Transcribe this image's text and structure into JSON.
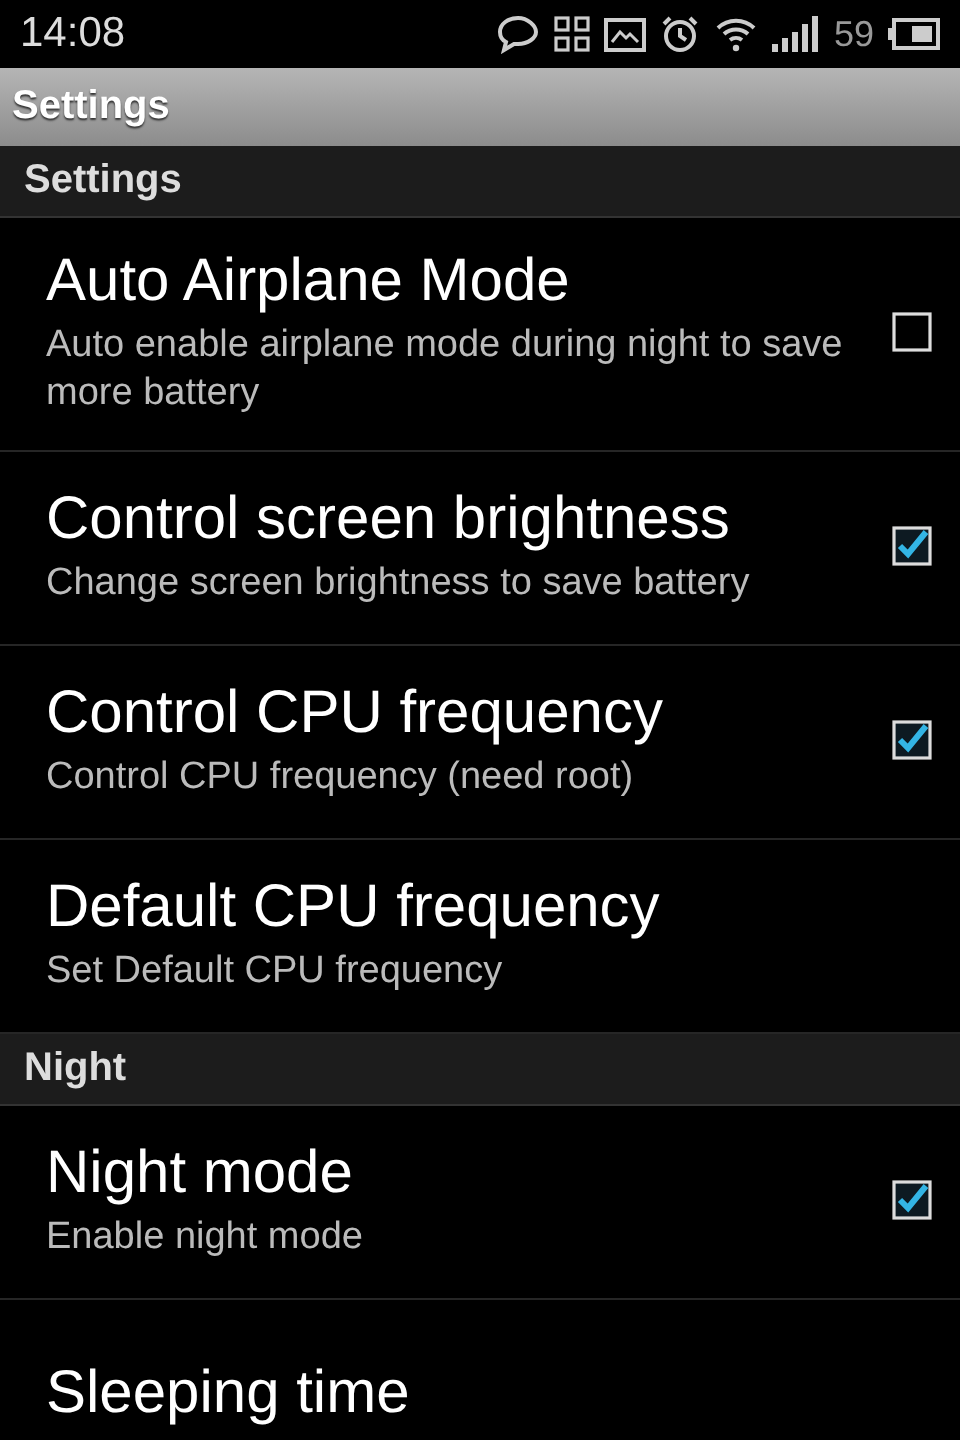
{
  "status_bar": {
    "time": "14:08",
    "battery": "59"
  },
  "window": {
    "title": "Settings"
  },
  "sections": [
    {
      "header": "Settings",
      "items": [
        {
          "kind": "checkbox",
          "title": "Auto Airplane Mode",
          "summary": "Auto enable airplane mode during night to save more battery",
          "checked": false
        },
        {
          "kind": "checkbox",
          "title": "Control screen brightness",
          "summary": "Change screen brightness to save battery",
          "checked": true
        },
        {
          "kind": "checkbox",
          "title": "Control CPU frequency",
          "summary": "Control CPU frequency (need root)",
          "checked": true
        },
        {
          "kind": "plain",
          "title": "Default CPU frequency",
          "summary": "Set Default CPU frequency"
        }
      ]
    },
    {
      "header": "Night",
      "items": [
        {
          "kind": "checkbox",
          "title": "Night mode",
          "summary": "Enable night mode",
          "checked": true
        },
        {
          "kind": "plain",
          "title": "Sleeping time"
        }
      ]
    }
  ]
}
